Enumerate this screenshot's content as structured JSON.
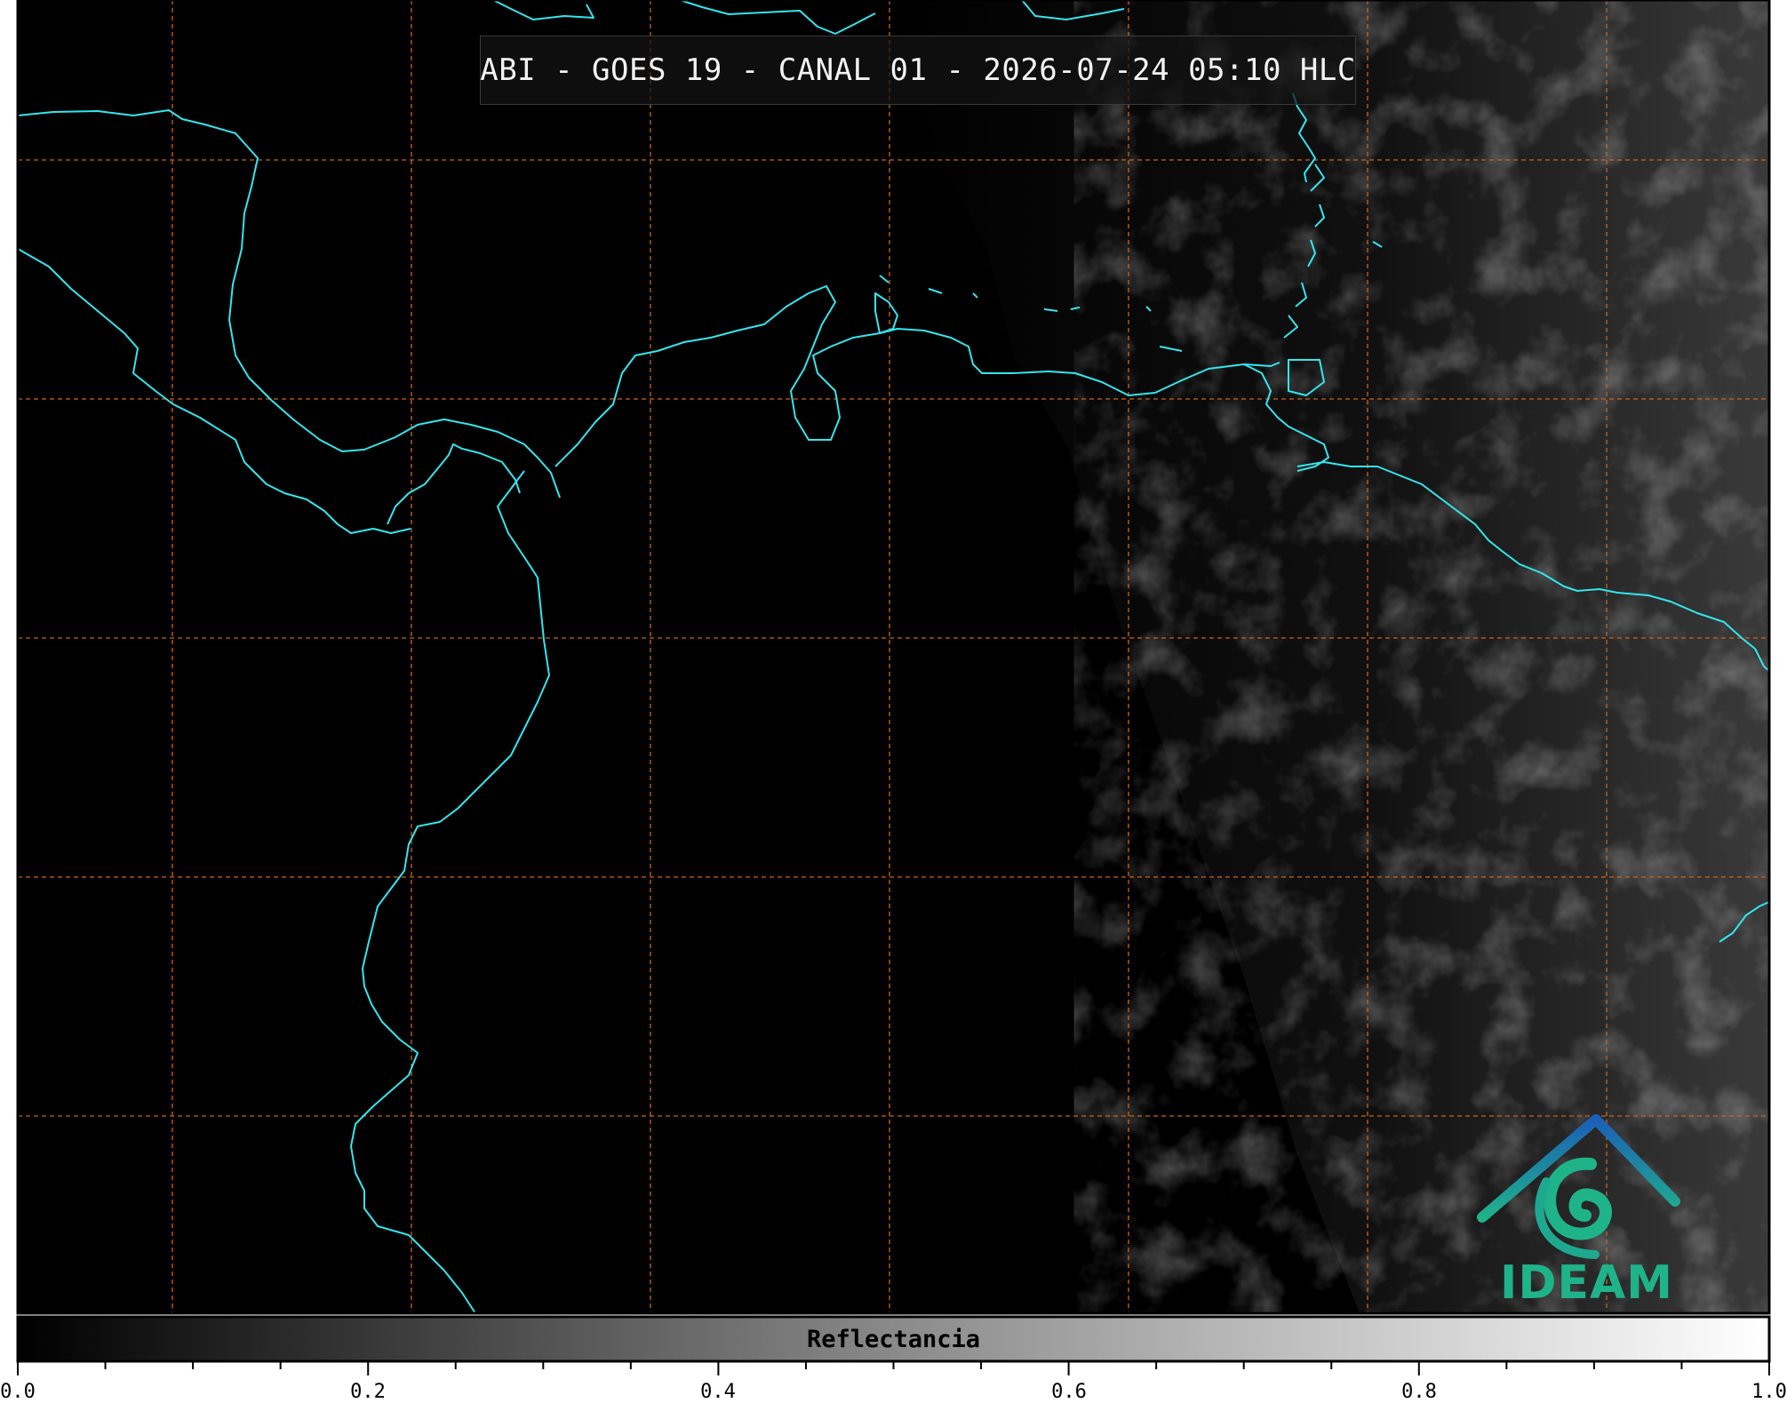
{
  "title": "ABI - GOES 19 - CANAL 01 - 2026-07-24 05:10 HLC",
  "colorbar": {
    "label": "Reflectancia",
    "ticks": [
      "0.0",
      "0.2",
      "0.4",
      "0.6",
      "0.8",
      "1.0"
    ]
  },
  "logo": {
    "text": "IDEAM",
    "color": "#1fb38a"
  },
  "colors": {
    "coastline": "#33e6ee",
    "gridline": "#c8641e",
    "background": "#000000"
  }
}
